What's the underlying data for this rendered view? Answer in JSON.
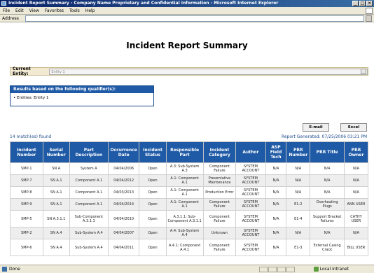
{
  "window": {
    "title": "Incident Report Summary - Company Name Proprietary and Confidential Information - Microsoft Internet Explorer",
    "minimize": "_",
    "maximize": "□",
    "close": "×"
  },
  "menu": [
    "File",
    "Edit",
    "View",
    "Favorites",
    "Tools",
    "Help"
  ],
  "address": {
    "label": "Address",
    "value": ""
  },
  "page": {
    "title": "Incident Report Summary"
  },
  "entity": {
    "label": "Current Entity:",
    "value": "Entity 1"
  },
  "qualifier": {
    "heading": "Results based on the following qualifier(s):",
    "item": "Entities: Entity 1"
  },
  "buttons": {
    "email": "E-mail",
    "excel": "Excel"
  },
  "summary": {
    "match_count": "14 match(es) found",
    "report_generated": "Report Generated: 07/25/2006 03:21 PM"
  },
  "table": {
    "headers": [
      "Incident Number",
      "Serial Number",
      "Part Description",
      "Occurrence Date",
      "Incident Status",
      "Responsible Part",
      "Incident Category",
      "Author",
      "ASP Field Tech",
      "PRR Number",
      "PRR Title",
      "PRR Owner"
    ],
    "rows": [
      [
        "SMP-1",
        "SN A",
        "System A",
        "04/04/2006",
        "Open",
        "A.3: Sub-System A.3",
        "Component Failure",
        "SYSTEM ACCOUNT",
        "N/A",
        "N/A",
        "N/A",
        "N/A"
      ],
      [
        "SMP-7",
        "SN A.1",
        "Component A.1",
        "04/04/2012",
        "Open",
        "A.1: Component A.1",
        "Preventative Maintenance",
        "SYSTEM ACCOUNT",
        "N/A",
        "N/A",
        "N/A",
        "N/A"
      ],
      [
        "SMP-8",
        "SN A.1",
        "Component A.1",
        "04/03/2013",
        "Open",
        "A.1: Component A.1",
        "Production Error",
        "SYSTEM ACCOUNT",
        "N/A",
        "N/A",
        "N/A",
        "N/A"
      ],
      [
        "SMP-9",
        "SN A.1",
        "Component A.1",
        "04/04/2014",
        "Open",
        "A.1: Component A.1",
        "Component Failure",
        "SYSTEM ACCOUNT",
        "N/A",
        "E1-2",
        "Overheating Plugs",
        "ANN USER"
      ],
      [
        "SMP-5",
        "SN A.3.1.1",
        "Sub-Component A.3.1.1",
        "04/04/2010",
        "Open",
        "A.3.1.1: Sub-Component A.3.1.1",
        "Component Failure",
        "SYSTEM ACCOUNT",
        "N/A",
        "E1-4",
        "Support Bracket Failures",
        "CATHY USER"
      ],
      [
        "SMP-2",
        "SN A.4",
        "Sub-System A.4",
        "04/04/2007",
        "Open",
        "A.4: Sub-System A.4",
        "Unknown",
        "SYSTEM ACCOUNT",
        "N/A",
        "N/A",
        "N/A",
        "N/A"
      ],
      [
        "SMP-6",
        "SN A.4",
        "Sub-System A.4",
        "04/04/2011",
        "Open",
        "A.4.1: Component A.4.1",
        "Component Failure",
        "SYSTEM ACCOUNT",
        "N/A",
        "E1-3",
        "External Casing Crack",
        "BILL USER"
      ]
    ]
  },
  "status": {
    "text": "Done",
    "zone": "Local intranet"
  }
}
